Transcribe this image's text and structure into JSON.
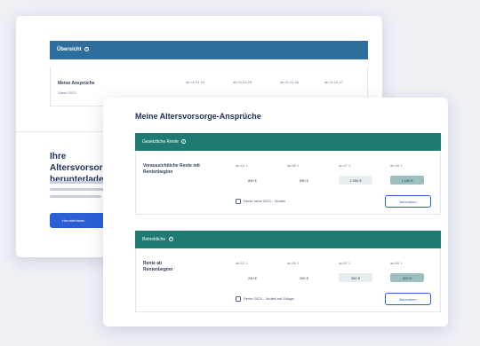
{
  "back_card": {
    "bar_label": "Übersicht",
    "row_label": "Meine Ansprüche",
    "row_sub": "Stand 2023",
    "year_heads": [
      "ab 01.01.24",
      "ab 01.01.25",
      "ab 01.01.26",
      "ab 01.01.27"
    ],
    "title": "Ihre Altersvorsorge herunterladen",
    "cta_label": "Herunterladen"
  },
  "front_card": {
    "title": "Meine Altersvorsorge-Ansprüche",
    "sections": [
      {
        "bar_label": "Gesetzliche Rente",
        "row_label": "Voraussichtliche Rente mit Rentenbeginn",
        "year_heads": [
          "ab 63 J.",
          "ab 65 J.",
          "ab 67 J.",
          "ab 69 J."
        ],
        "values": [
          "850 €",
          "950 €",
          "1.050 €",
          "1.150 €"
        ],
        "checkbox_label": "Rente ohne 2023 – Modell",
        "button_label": "Berechnen"
      },
      {
        "bar_label": "Betriebliche",
        "row_label": "Rente ab Rentenbeginn",
        "year_heads": [
          "ab 63 J.",
          "ab 65 J.",
          "ab 67 J.",
          "ab 69 J."
        ],
        "values": [
          "250 €",
          "300 €",
          "350 €",
          "400 €"
        ],
        "checkbox_label": "Rente 2023 – Modell mit Zulage",
        "button_label": "Berechnen"
      }
    ]
  }
}
